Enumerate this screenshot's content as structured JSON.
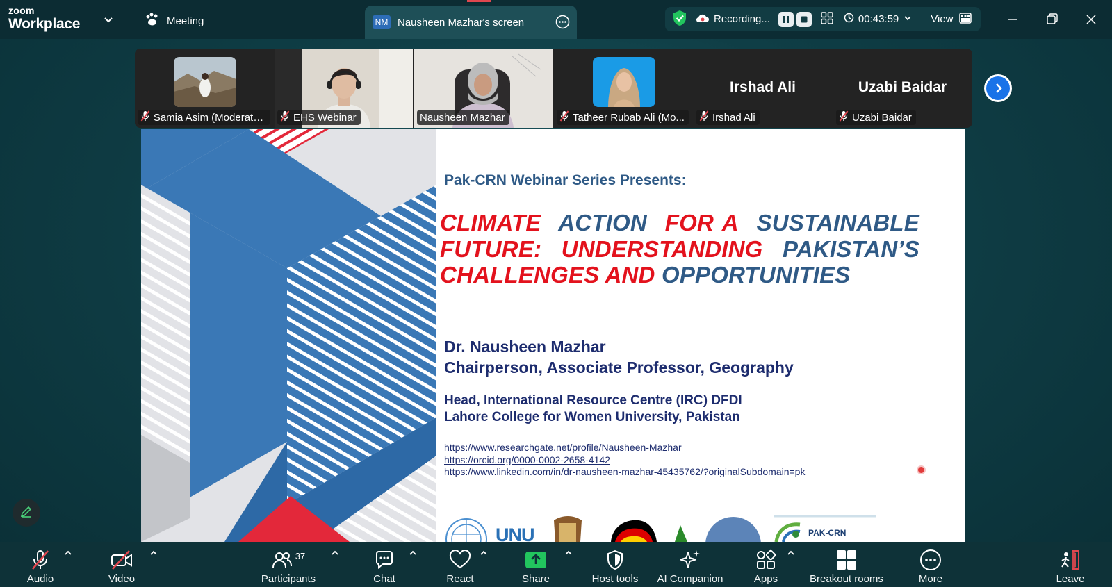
{
  "app": {
    "brand_top": "zoom",
    "brand_bottom": "Workplace",
    "meeting_label": "Meeting"
  },
  "screen_tab": {
    "badge": "NM",
    "label": "Nausheen Mazhar's screen"
  },
  "recording": {
    "label": "Recording...",
    "timer": "00:43:59",
    "view_label": "View"
  },
  "participants": [
    {
      "name": "Samia Asim (Moderato...",
      "muted": true,
      "type": "photo"
    },
    {
      "name": "EHS Webinar",
      "muted": true,
      "type": "video"
    },
    {
      "name": "Nausheen Mazhar",
      "muted": false,
      "type": "video",
      "active": true
    },
    {
      "name": "Tatheer Rubab Ali (Mo...",
      "muted": true,
      "type": "photo"
    },
    {
      "name": "Irshad Ali",
      "display": "Irshad Ali",
      "muted": true,
      "type": "name"
    },
    {
      "name": "Uzabi Baidar",
      "display": "Uzabi Baidar",
      "muted": true,
      "type": "name"
    }
  ],
  "slide": {
    "series": "Pak-CRN Webinar Series Presents:",
    "title_parts": [
      {
        "text": "CLIMATE",
        "color": "red"
      },
      {
        "text": "ACTION",
        "color": "blue"
      },
      {
        "text": "FOR A",
        "color": "red"
      },
      {
        "text": "SUSTAINABLE",
        "color": "blue"
      },
      {
        "text": "FUTURE:",
        "color": "red"
      },
      {
        "text": "UNDERSTANDING",
        "color": "red"
      },
      {
        "text": "PAKISTAN’S",
        "color": "blue"
      },
      {
        "text": "CHALLENGES AND",
        "color": "red"
      },
      {
        "text": "OPPORTUNITIES",
        "color": "blue"
      }
    ],
    "speaker_name": "Dr. Nausheen Mazhar",
    "speaker_role": "Chairperson, Associate Professor, Geography",
    "inst_line1": "Head, International Resource Centre (IRC) DFDI",
    "inst_line2": "Lahore College for Women University, Pakistan",
    "link1": "https://www.researchgate.net/profile/Nausheen-Mazhar",
    "link2": "https://orcid.org/0000-0002-2658-4142",
    "link3": "https://www.linkedin.com/in/dr-nausheen-mazhar-45435762/?originalSubdomain=pk",
    "logo_unu": "UNU",
    "logo_pakcrn": "PAK-CRN"
  },
  "toolbar": {
    "audio": "Audio",
    "video": "Video",
    "participants": "Participants",
    "participant_count": "37",
    "chat": "Chat",
    "react": "React",
    "share": "Share",
    "host_tools": "Host tools",
    "ai_companion": "AI Companion",
    "apps": "Apps",
    "breakout_rooms": "Breakout rooms",
    "more": "More",
    "leave": "Leave"
  },
  "colors": {
    "accent_green": "#23d86f",
    "slide_red": "#e3121d",
    "slide_blue": "#2f5a86",
    "share_green": "#22c55e",
    "next_blue": "#1a73e8"
  }
}
